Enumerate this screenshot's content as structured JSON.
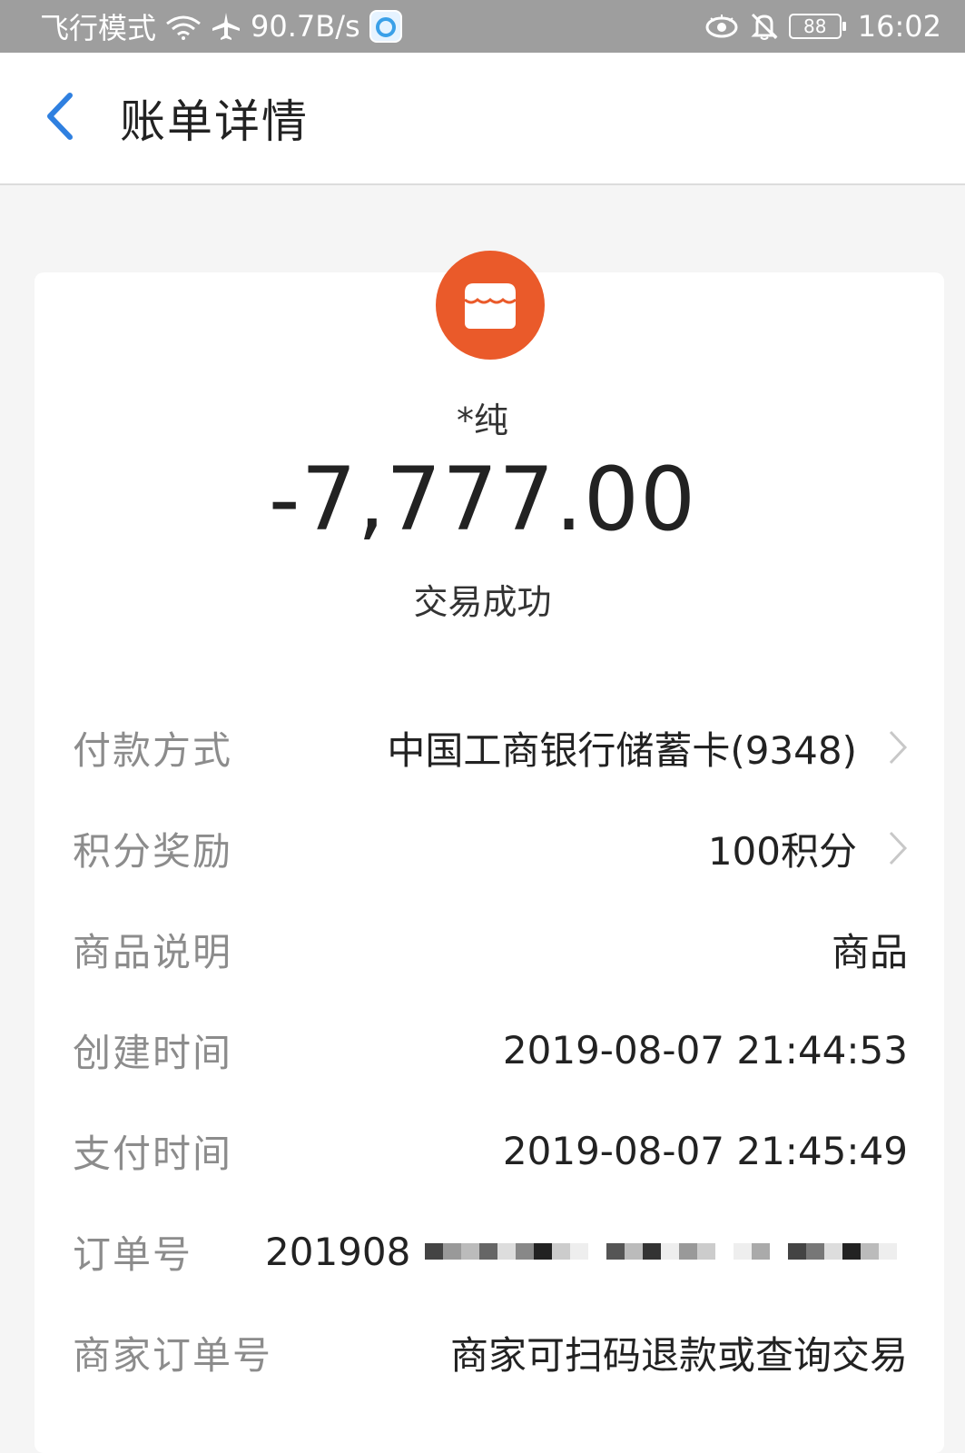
{
  "status_bar": {
    "mode": "飞行模式",
    "speed": "90.7B/s",
    "battery": "88",
    "time": "16:02",
    "icons": [
      "wifi-icon",
      "airplane-icon",
      "app-badge-icon",
      "eye-icon",
      "bell-off-icon",
      "battery-icon"
    ]
  },
  "header": {
    "title": "账单详情",
    "back_icon": "chevron-left-icon"
  },
  "merchant": {
    "icon": "store-icon",
    "name": "*纯",
    "amount": "-7,777.00",
    "status": "交易成功"
  },
  "details": {
    "payment_method": {
      "label": "付款方式",
      "value": "中国工商银行储蓄卡(9348)"
    },
    "points": {
      "label": "积分奖励",
      "value": "100积分"
    },
    "product": {
      "label": "商品说明",
      "value": "商品"
    },
    "created": {
      "label": "创建时间",
      "value": "2019-08-07 21:44:53"
    },
    "paid": {
      "label": "支付时间",
      "value": "2019-08-07 21:45:49"
    },
    "order_no": {
      "label": "订单号",
      "value": "201908"
    },
    "merchant_order": {
      "label": "商家订单号",
      "value": "商家可扫码退款或查询交易"
    }
  },
  "colors": {
    "accent": "#2f80e0",
    "merchant_icon": "#ea5a2a",
    "status_bar": "#9e9e9e"
  }
}
